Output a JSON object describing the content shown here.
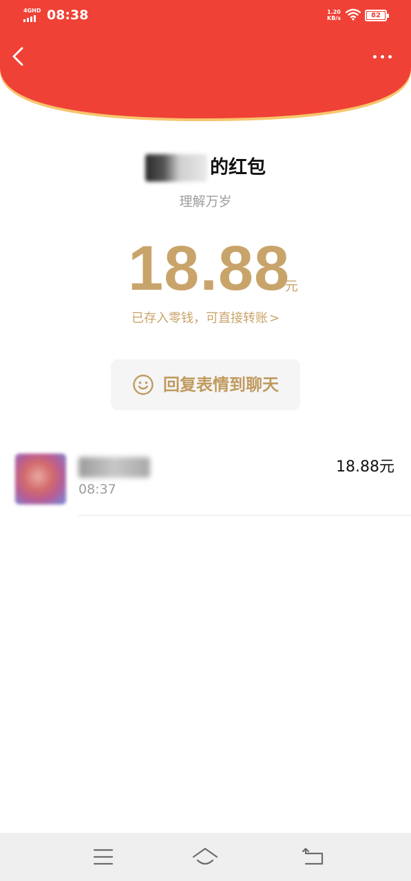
{
  "status_bar": {
    "network": "4GHD",
    "time": "08:38",
    "speed_value": "1.20",
    "speed_unit": "KB/s",
    "battery": "82"
  },
  "header": {
    "back_icon": "chevron-left-icon",
    "more_icon": "more-dots-icon",
    "color": "#ef4136"
  },
  "packet": {
    "sender_suffix": "的红包",
    "greeting": "理解万岁",
    "amount": "18.88",
    "unit": "元",
    "wallet_note": "已存入零钱，可直接转账",
    "chevron": ">",
    "reply_label": "回复表情到聊天",
    "reply_icon": "smile-icon",
    "accent_color": "#c9a46a"
  },
  "records": [
    {
      "time": "08:37",
      "amount": "18.88元"
    }
  ],
  "nav": {
    "menu_icon": "menu-icon",
    "home_icon": "home-icon",
    "back_icon": "return-icon"
  }
}
